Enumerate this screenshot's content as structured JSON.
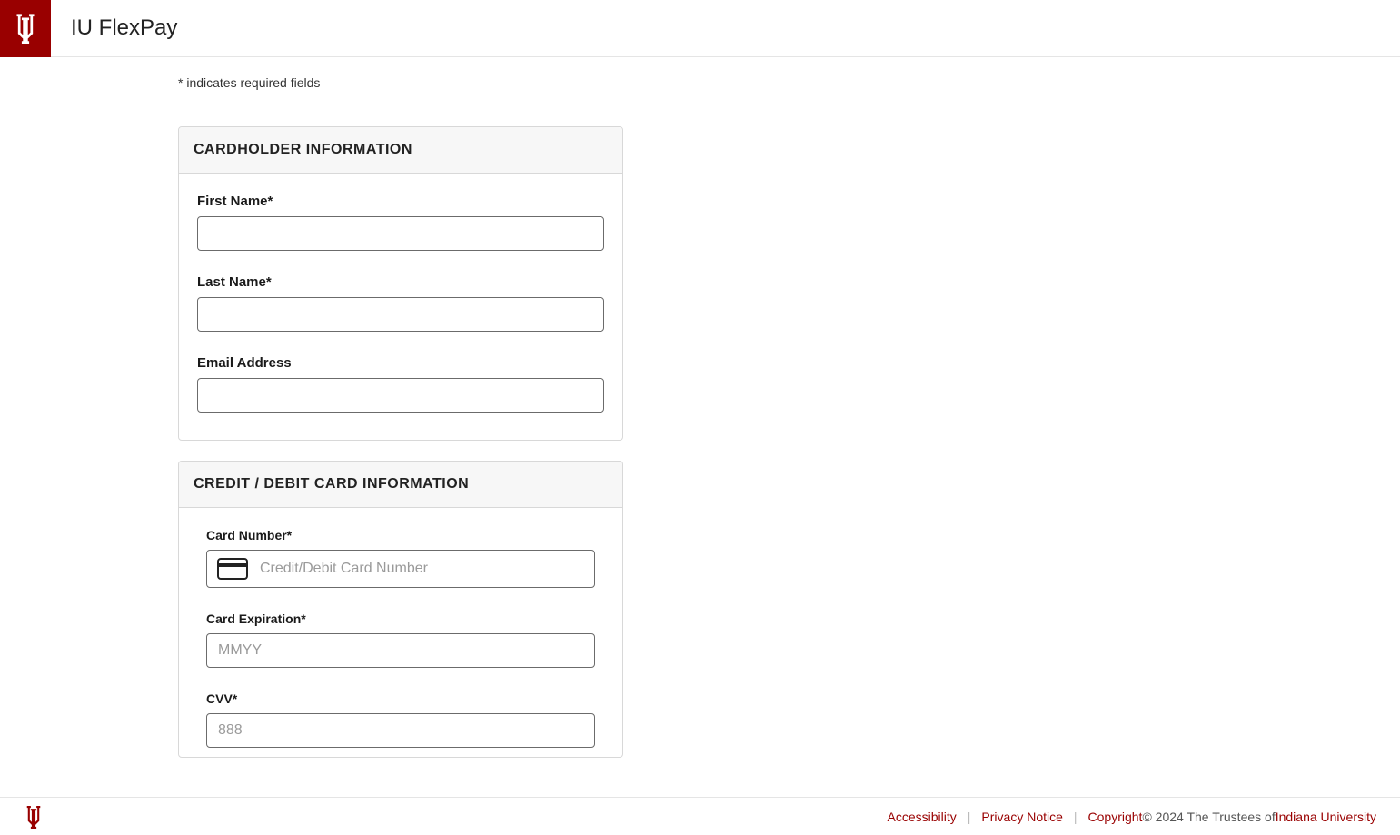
{
  "header": {
    "app_title": "IU FlexPay"
  },
  "form": {
    "required_note": "* indicates required fields",
    "cardholder": {
      "panel_title": "CARDHOLDER INFORMATION",
      "first_name_label": "First Name*",
      "first_name_value": "",
      "last_name_label": "Last Name*",
      "last_name_value": "",
      "email_label": "Email Address",
      "email_value": ""
    },
    "card": {
      "panel_title": "CREDIT / DEBIT CARD INFORMATION",
      "number_label": "Card Number*",
      "number_placeholder": "Credit/Debit Card Number",
      "number_value": "",
      "expiration_label": "Card Expiration*",
      "expiration_placeholder": "MMYY",
      "expiration_value": "",
      "cvv_label": "CVV*",
      "cvv_placeholder": "888",
      "cvv_value": ""
    }
  },
  "footer": {
    "accessibility": "Accessibility",
    "privacy": "Privacy Notice",
    "copyright_link": "Copyright",
    "copyright_text": " © 2024 The Trustees of ",
    "iu_link": "Indiana University"
  }
}
